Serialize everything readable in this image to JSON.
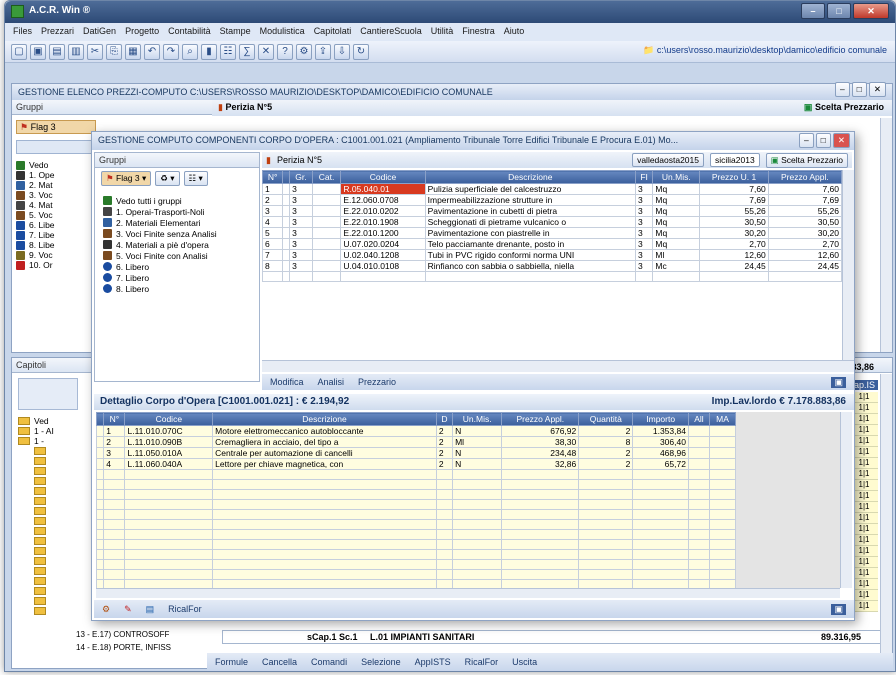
{
  "app": {
    "title": "A.C.R. Win ®",
    "path": "c:\\users\\rosso.maurizio\\desktop\\damico\\edificio comunale"
  },
  "menu": [
    "Files",
    "Prezzari",
    "DatiGen",
    "Progetto",
    "Contabilità",
    "Stampe",
    "Modulistica",
    "Capitolati",
    "CantiereScuola",
    "Utilità",
    "Finestra",
    "Aiuto"
  ],
  "bg_window": {
    "title": "GESTIONE ELENCO PREZZI-COMPUTO C:\\USERS\\ROSSO MAURIZIO\\DESKTOP\\DAMICO\\EDIFICIO COMUNALE",
    "groups_label": "Gruppi",
    "perizia_label": "Perizia N°5",
    "scelta_label": "Scelta Prezzario",
    "flag_label": "Flag 3",
    "left_items": [
      "Vedo",
      "1. Ope",
      "2. Mat",
      "3. Voc",
      "4. Mat",
      "5. Voc",
      "6. Libe",
      "7. Libe",
      "8. Libe",
      "9. Voc",
      "10. Or"
    ],
    "right_totals": [
      "883,86",
      "89.316,95"
    ],
    "cap_label": "Cap.IS",
    "bottom_row": {
      "tag": "sCap.1 Sc.1",
      "desc": "L.01 IMPIANTI SANITARI",
      "value": "89.316,95"
    }
  },
  "capitoli": {
    "label": "Capitoli",
    "tree_top": [
      "Ved",
      "1 - AI",
      "1 -"
    ],
    "bottom_items": [
      "13 - E.17) CONTROSOFF",
      "14 - E.18) PORTE, INFISS"
    ]
  },
  "fg_window": {
    "title": "GESTIONE COMPUTO COMPONENTI CORPO D'OPERA : C1001.001.021 (Ampliamento Tribunale Torre  Edifici Tribunale E Procura  E.01) Mo...",
    "groups_label": "Gruppi",
    "perizia_label": "Perizia N°5",
    "tabs": [
      "valledaosta2015",
      "sicilia2013"
    ],
    "scelta_label": "Scelta Prezzario",
    "flag_label": "Flag 3",
    "tree": [
      {
        "label": "Vedo tutti i gruppi",
        "icon": "group-icon"
      },
      {
        "label": "1. Operai-Trasporti-Noli",
        "icon": "worker-icon"
      },
      {
        "label": "2. Materiali Elementari",
        "icon": "tools-icon"
      },
      {
        "label": "3. Voci Finite senza Analisi",
        "icon": "brick-icon"
      },
      {
        "label": "4. Materiali a piè d'opera",
        "icon": "truck-icon"
      },
      {
        "label": "5. Voci Finite con Analisi",
        "icon": "wall-icon"
      },
      {
        "label": "6. Libero",
        "icon": "circle-icon"
      },
      {
        "label": "7. Libero",
        "icon": "circle-icon"
      },
      {
        "label": "8. Libero",
        "icon": "circle-icon"
      }
    ],
    "top_table": {
      "headers": [
        "N°",
        "",
        "Gr.",
        "Cat.",
        "Codice",
        "Descrizione",
        "FI",
        "Un.Mis.",
        "Prezzo U. 1",
        "Prezzo Appl."
      ],
      "rows": [
        {
          "n": "1",
          "gr": "3",
          "code": "R.05.040.01",
          "desc": "Pulizia superficiale del calcestruzzo",
          "fi": "3",
          "um": "Mq",
          "p1": "7,60",
          "pa": "7,60"
        },
        {
          "n": "2",
          "gr": "3",
          "code": "E.12.060.0708",
          "desc": "Impermeabilizzazione strutture in",
          "fi": "3",
          "um": "Mq",
          "p1": "7,69",
          "pa": "7,69"
        },
        {
          "n": "3",
          "gr": "3",
          "code": "E.22.010.0202",
          "desc": "Pavimentazione in cubetti di pietra",
          "fi": "3",
          "um": "Mq",
          "p1": "55,26",
          "pa": "55,26"
        },
        {
          "n": "4",
          "gr": "3",
          "code": "E.22.010.1908",
          "desc": "Scheggionati di pietrame vulcanico o",
          "fi": "3",
          "um": "Mq",
          "p1": "30,50",
          "pa": "30,50"
        },
        {
          "n": "5",
          "gr": "3",
          "code": "E.22.010.1200",
          "desc": "Pavimentazione con piastrelle in",
          "fi": "3",
          "um": "Mq",
          "p1": "30,20",
          "pa": "30,20"
        },
        {
          "n": "6",
          "gr": "3",
          "code": "U.07.020.0204",
          "desc": "Telo pacciamante drenante, posto in",
          "fi": "3",
          "um": "Mq",
          "p1": "2,70",
          "pa": "2,70"
        },
        {
          "n": "7",
          "gr": "3",
          "code": "U.02.040.1208",
          "desc": "Tubi in PVC rigido conformi norma UNI",
          "fi": "3",
          "um": "Ml",
          "p1": "12,60",
          "pa": "12,60"
        },
        {
          "n": "8",
          "gr": "3",
          "code": "U.04.010.0108",
          "desc": "Rinfianco con sabbia o sabbiella, niella",
          "fi": "3",
          "um": "Mc",
          "p1": "24,45",
          "pa": "24,45"
        }
      ]
    },
    "bottom_buttons": [
      "Modifica",
      "Analisi",
      "Prezzario"
    ],
    "dettaglio": {
      "title": "Dettaglio  Corpo d'Opera  [C1001.001.021]   :   € 2.194,92",
      "imp_lordo": "Imp.Lav.lordo € 7.178.883,86",
      "headers": [
        "",
        "N°",
        "Codice",
        "Descrizione",
        "D",
        "Un.Mis.",
        "Prezzo Appl.",
        "Quantità",
        "Importo",
        "All",
        "MA"
      ],
      "rows": [
        {
          "n": "1",
          "code": "L.11.010.070C",
          "desc": "Motore elettromeccanico autobloccante",
          "d": "2",
          "um": "N",
          "price": "676,92",
          "qty": "2",
          "imp": "1.353,84"
        },
        {
          "n": "2",
          "code": "L.11.010.090B",
          "desc": "Cremagliera in acciaio, del tipo a",
          "d": "2",
          "um": "Ml",
          "price": "38,30",
          "qty": "8",
          "imp": "306,40"
        },
        {
          "n": "3",
          "code": "L.11.050.010A",
          "desc": "Centrale per automazione di cancelli",
          "d": "2",
          "um": "N",
          "price": "234,48",
          "qty": "2",
          "imp": "468,96"
        },
        {
          "n": "4",
          "code": "L.11.060.040A",
          "desc": "Lettore per chiave magnetica, con",
          "d": "2",
          "um": "N",
          "price": "32,86",
          "qty": "2",
          "imp": "65,72"
        }
      ],
      "footer_label": "RicalFor"
    }
  },
  "bottom_bar": [
    "Formule",
    "Cancella",
    "Comandi",
    "Selezione",
    "AppISTS",
    "RicalFor",
    "Uscita"
  ],
  "colors": {
    "accent": "#3b5f9c",
    "title": "#2d4a76",
    "selected_code": "#d83a20"
  }
}
